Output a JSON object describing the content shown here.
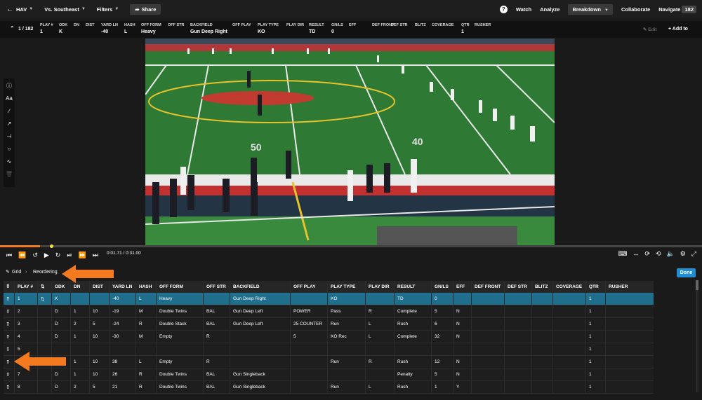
{
  "topnav": {
    "team": "HAV",
    "opponent": "Vs. Southeast",
    "filters": "Filters",
    "share": "Share",
    "help": "?",
    "watch": "Watch",
    "analyze": "Analyze",
    "breakdown": "Breakdown",
    "collaborate": "Collaborate",
    "navigate": "Navigate",
    "navigate_count": "182"
  },
  "info": {
    "clip_count": "1 / 182",
    "columns": [
      {
        "label": "PLAY #",
        "value": "1"
      },
      {
        "label": "ODK",
        "value": "K"
      },
      {
        "label": "DN",
        "value": ""
      },
      {
        "label": "DIST",
        "value": ""
      },
      {
        "label": "YARD LN",
        "value": "-40"
      },
      {
        "label": "HASH",
        "value": "L"
      },
      {
        "label": "OFF FORM",
        "value": "Heavy"
      },
      {
        "label": "OFF STR",
        "value": ""
      },
      {
        "label": "BACKFIELD",
        "value": "Gun Deep Right"
      },
      {
        "label": "OFF PLAY",
        "value": ""
      },
      {
        "label": "PLAY TYPE",
        "value": "KO"
      },
      {
        "label": "PLAY DIR",
        "value": ""
      },
      {
        "label": "RESULT",
        "value": "TD"
      },
      {
        "label": "GN/LS",
        "value": "0"
      },
      {
        "label": "EFF",
        "value": ""
      },
      {
        "label": "DEF FRONT",
        "value": ""
      },
      {
        "label": "DEF STR",
        "value": ""
      },
      {
        "label": "BLITZ",
        "value": ""
      },
      {
        "label": "COVERAGE",
        "value": ""
      },
      {
        "label": "QTR",
        "value": "1"
      },
      {
        "label": "RUSHER",
        "value": ""
      }
    ],
    "edit": "Edit",
    "add_to": "Add to"
  },
  "tools": [
    "info-icon",
    "text-tool",
    "line-tool",
    "arrow-tool",
    "t-arrow-tool",
    "circle-tool",
    "freehand-tool",
    "trash-icon"
  ],
  "tool_labels": {
    "text": "Aa"
  },
  "player": {
    "time": "0:01.71 / 0:31.00",
    "progress": 0.057,
    "field_numbers": [
      "50",
      "40"
    ]
  },
  "grid": {
    "breadcrumb_grid": "Grid",
    "breadcrumb_current": "Reordering",
    "done": "Done",
    "headers": [
      "PLAY #",
      "",
      "ODK",
      "DN",
      "DIST",
      "YARD LN",
      "HASH",
      "OFF FORM",
      "OFF STR",
      "BACKFIELD",
      "OFF PLAY",
      "PLAY TYPE",
      "PLAY DIR",
      "RESULT",
      "GN/LS",
      "EFF",
      "DEF FRONT",
      "DEF STR",
      "BLITZ",
      "COVERAGE",
      "QTR",
      "RUSHER"
    ],
    "rows": [
      [
        "1",
        "",
        "K",
        "",
        "",
        "-40",
        "L",
        "Heavy",
        "",
        "Gun Deep Right",
        "",
        "KO",
        "",
        "TD",
        "0",
        "",
        "",
        "",
        "",
        "",
        "1",
        ""
      ],
      [
        "2",
        "",
        "D",
        "1",
        "10",
        "-19",
        "M",
        "Double Twins",
        "BAL",
        "Gun Deep Left",
        "POWER",
        "Pass",
        "R",
        "Complete",
        "5",
        "N",
        "",
        "",
        "",
        "",
        "1",
        ""
      ],
      [
        "3",
        "",
        "D",
        "2",
        "5",
        "-24",
        "R",
        "Double Stack",
        "BAL",
        "Gun Deep Left",
        "25 COUNTER",
        "Run",
        "L",
        "Rush",
        "6",
        "N",
        "",
        "",
        "",
        "",
        "1",
        ""
      ],
      [
        "4",
        "",
        "D",
        "1",
        "10",
        "-30",
        "M",
        "Empty",
        "R",
        "",
        "5",
        "KO Rec",
        "L",
        "Complete",
        "32",
        "N",
        "",
        "",
        "",
        "",
        "1",
        ""
      ],
      [
        "5",
        "",
        "",
        "",
        "",
        "",
        "",
        "",
        "",
        "",
        "",
        "",
        "",
        "",
        "",
        "",
        "",
        "",
        "",
        "",
        "1",
        ""
      ],
      [
        "",
        "",
        "",
        "1",
        "10",
        "38",
        "L",
        "Empty",
        "R",
        "",
        "",
        "Run",
        "R",
        "Rush",
        "12",
        "N",
        "",
        "",
        "",
        "",
        "1",
        ""
      ],
      [
        "7",
        "",
        "D",
        "1",
        "10",
        "26",
        "R",
        "Double Twins",
        "BAL",
        "Gun Singleback",
        "",
        "",
        "",
        "Penalty",
        "5",
        "N",
        "",
        "",
        "",
        "",
        "1",
        ""
      ],
      [
        "8",
        "",
        "D",
        "2",
        "5",
        "21",
        "R",
        "Double Twins",
        "BAL",
        "Gun Singleback",
        "",
        "Run",
        "L",
        "Rush",
        "1",
        "Y",
        "",
        "",
        "",
        "",
        "1",
        ""
      ]
    ]
  }
}
